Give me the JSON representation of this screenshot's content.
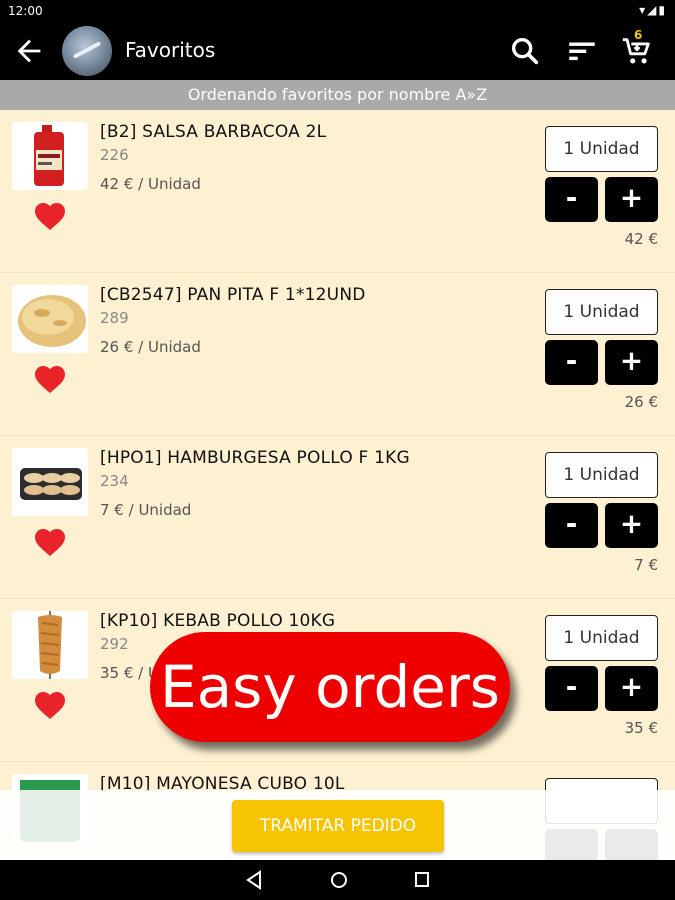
{
  "status": {
    "time": "12:00"
  },
  "appbar": {
    "title": "Favoritos",
    "cart_count": "6"
  },
  "sort_banner": "Ordenando favoritos por nombre A»Z",
  "products": [
    {
      "name": "[B2] SALSA BARBACOA 2L",
      "code": "226",
      "price": "42 € / Unidad",
      "qty": "1 Unidad",
      "total": "42 €",
      "image": "sauce-bottle"
    },
    {
      "name": "[CB2547] PAN PITA F 1*12UND",
      "code": "289",
      "price": "26 € / Unidad",
      "qty": "1 Unidad",
      "total": "26 €",
      "image": "pita-bread"
    },
    {
      "name": "[HPO1] HAMBURGESA POLLO F 1KG",
      "code": "234",
      "price": "7 € / Unidad",
      "qty": "1 Unidad",
      "total": "7 €",
      "image": "burger-tray"
    },
    {
      "name": "[KP10] KEBAB POLLO 10KG",
      "code": "292",
      "price": "35 € / Unidad",
      "qty": "1 Unidad",
      "total": "35 €",
      "image": "kebab-meat"
    },
    {
      "name": "[M10] MAYONESA CUBO 10L",
      "code": "",
      "price": "",
      "qty": "",
      "total": "",
      "image": "mayo-bucket"
    }
  ],
  "buttons": {
    "minus": "-",
    "plus": "+",
    "tramitar": "TRAMITAR PEDIDO"
  },
  "promo": "Easy orders",
  "colors": {
    "accent": "#f6c400",
    "heart": "#e8232a",
    "background": "#fdf1d2",
    "promo": "#ef0000"
  }
}
